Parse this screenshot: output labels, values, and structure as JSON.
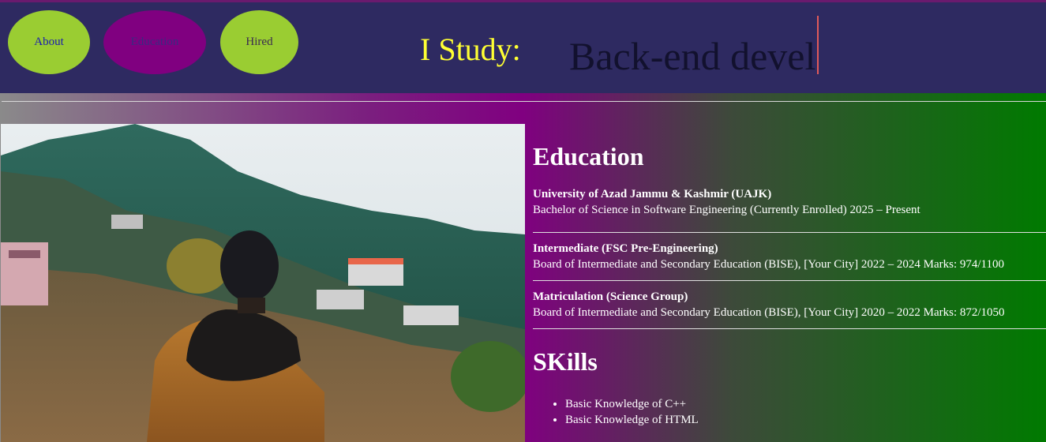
{
  "nav": {
    "about": "About",
    "education": "Education",
    "hired": "Hired"
  },
  "header": {
    "study_label": "I Study:",
    "typed_text": "Back-end devel"
  },
  "photo": {
    "alt": "Person in orange jacket looking at hillside village"
  },
  "education": {
    "heading": "Education",
    "items": [
      {
        "title": "University of Azad Jammu & Kashmir (UAJK)",
        "detail": "Bachelor of Science in Software Engineering (Currently Enrolled) 2025 – Present"
      },
      {
        "title": "Intermediate (FSC Pre-Engineering)",
        "detail": "Board of Intermediate and Secondary Education (BISE), [Your City] 2022 – 2024 Marks: 974/1100"
      },
      {
        "title": "Matriculation (Science Group)",
        "detail": "Board of Intermediate and Secondary Education (BISE), [Your City] 2020 – 2022 Marks: 872/1050"
      }
    ]
  },
  "skills": {
    "heading": "SKills",
    "items": [
      "Basic Knowledge of C++",
      "Basic Knowledge of HTML"
    ]
  },
  "colors": {
    "topbar": "#2e2a61",
    "nav_green": "#9acd32",
    "nav_purple": "#800080",
    "study_label": "#ffff33"
  }
}
